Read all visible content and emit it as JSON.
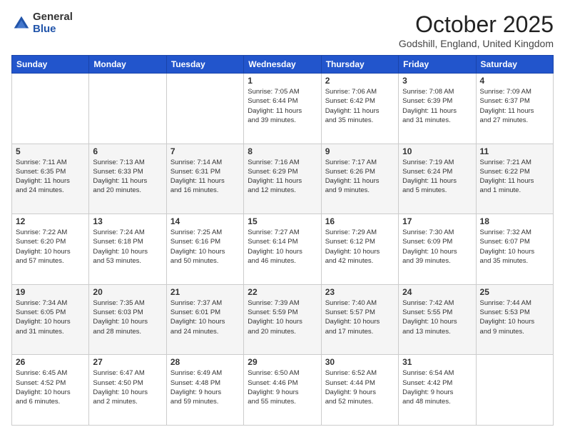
{
  "logo": {
    "general": "General",
    "blue": "Blue"
  },
  "header": {
    "month": "October 2025",
    "location": "Godshill, England, United Kingdom"
  },
  "days_of_week": [
    "Sunday",
    "Monday",
    "Tuesday",
    "Wednesday",
    "Thursday",
    "Friday",
    "Saturday"
  ],
  "weeks": [
    [
      {
        "day": "",
        "info": ""
      },
      {
        "day": "",
        "info": ""
      },
      {
        "day": "",
        "info": ""
      },
      {
        "day": "1",
        "info": "Sunrise: 7:05 AM\nSunset: 6:44 PM\nDaylight: 11 hours\nand 39 minutes."
      },
      {
        "day": "2",
        "info": "Sunrise: 7:06 AM\nSunset: 6:42 PM\nDaylight: 11 hours\nand 35 minutes."
      },
      {
        "day": "3",
        "info": "Sunrise: 7:08 AM\nSunset: 6:39 PM\nDaylight: 11 hours\nand 31 minutes."
      },
      {
        "day": "4",
        "info": "Sunrise: 7:09 AM\nSunset: 6:37 PM\nDaylight: 11 hours\nand 27 minutes."
      }
    ],
    [
      {
        "day": "5",
        "info": "Sunrise: 7:11 AM\nSunset: 6:35 PM\nDaylight: 11 hours\nand 24 minutes."
      },
      {
        "day": "6",
        "info": "Sunrise: 7:13 AM\nSunset: 6:33 PM\nDaylight: 11 hours\nand 20 minutes."
      },
      {
        "day": "7",
        "info": "Sunrise: 7:14 AM\nSunset: 6:31 PM\nDaylight: 11 hours\nand 16 minutes."
      },
      {
        "day": "8",
        "info": "Sunrise: 7:16 AM\nSunset: 6:29 PM\nDaylight: 11 hours\nand 12 minutes."
      },
      {
        "day": "9",
        "info": "Sunrise: 7:17 AM\nSunset: 6:26 PM\nDaylight: 11 hours\nand 9 minutes."
      },
      {
        "day": "10",
        "info": "Sunrise: 7:19 AM\nSunset: 6:24 PM\nDaylight: 11 hours\nand 5 minutes."
      },
      {
        "day": "11",
        "info": "Sunrise: 7:21 AM\nSunset: 6:22 PM\nDaylight: 11 hours\nand 1 minute."
      }
    ],
    [
      {
        "day": "12",
        "info": "Sunrise: 7:22 AM\nSunset: 6:20 PM\nDaylight: 10 hours\nand 57 minutes."
      },
      {
        "day": "13",
        "info": "Sunrise: 7:24 AM\nSunset: 6:18 PM\nDaylight: 10 hours\nand 53 minutes."
      },
      {
        "day": "14",
        "info": "Sunrise: 7:25 AM\nSunset: 6:16 PM\nDaylight: 10 hours\nand 50 minutes."
      },
      {
        "day": "15",
        "info": "Sunrise: 7:27 AM\nSunset: 6:14 PM\nDaylight: 10 hours\nand 46 minutes."
      },
      {
        "day": "16",
        "info": "Sunrise: 7:29 AM\nSunset: 6:12 PM\nDaylight: 10 hours\nand 42 minutes."
      },
      {
        "day": "17",
        "info": "Sunrise: 7:30 AM\nSunset: 6:09 PM\nDaylight: 10 hours\nand 39 minutes."
      },
      {
        "day": "18",
        "info": "Sunrise: 7:32 AM\nSunset: 6:07 PM\nDaylight: 10 hours\nand 35 minutes."
      }
    ],
    [
      {
        "day": "19",
        "info": "Sunrise: 7:34 AM\nSunset: 6:05 PM\nDaylight: 10 hours\nand 31 minutes."
      },
      {
        "day": "20",
        "info": "Sunrise: 7:35 AM\nSunset: 6:03 PM\nDaylight: 10 hours\nand 28 minutes."
      },
      {
        "day": "21",
        "info": "Sunrise: 7:37 AM\nSunset: 6:01 PM\nDaylight: 10 hours\nand 24 minutes."
      },
      {
        "day": "22",
        "info": "Sunrise: 7:39 AM\nSunset: 5:59 PM\nDaylight: 10 hours\nand 20 minutes."
      },
      {
        "day": "23",
        "info": "Sunrise: 7:40 AM\nSunset: 5:57 PM\nDaylight: 10 hours\nand 17 minutes."
      },
      {
        "day": "24",
        "info": "Sunrise: 7:42 AM\nSunset: 5:55 PM\nDaylight: 10 hours\nand 13 minutes."
      },
      {
        "day": "25",
        "info": "Sunrise: 7:44 AM\nSunset: 5:53 PM\nDaylight: 10 hours\nand 9 minutes."
      }
    ],
    [
      {
        "day": "26",
        "info": "Sunrise: 6:45 AM\nSunset: 4:52 PM\nDaylight: 10 hours\nand 6 minutes."
      },
      {
        "day": "27",
        "info": "Sunrise: 6:47 AM\nSunset: 4:50 PM\nDaylight: 10 hours\nand 2 minutes."
      },
      {
        "day": "28",
        "info": "Sunrise: 6:49 AM\nSunset: 4:48 PM\nDaylight: 9 hours\nand 59 minutes."
      },
      {
        "day": "29",
        "info": "Sunrise: 6:50 AM\nSunset: 4:46 PM\nDaylight: 9 hours\nand 55 minutes."
      },
      {
        "day": "30",
        "info": "Sunrise: 6:52 AM\nSunset: 4:44 PM\nDaylight: 9 hours\nand 52 minutes."
      },
      {
        "day": "31",
        "info": "Sunrise: 6:54 AM\nSunset: 4:42 PM\nDaylight: 9 hours\nand 48 minutes."
      },
      {
        "day": "",
        "info": ""
      }
    ]
  ]
}
